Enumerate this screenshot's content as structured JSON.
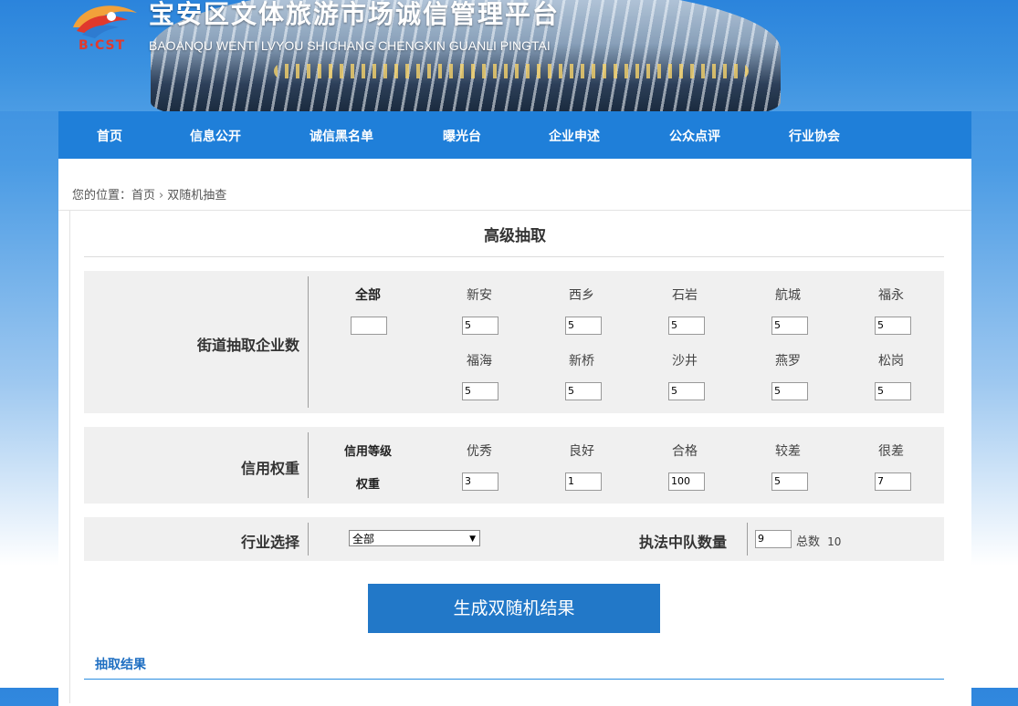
{
  "header": {
    "logo_text": "B·CST",
    "title": "宝安区文体旅游市场诚信管理平台",
    "subtitle": "BAOANQU WENTI LVYOU SHICHANG CHENGXIN GUANLI PINGTAI"
  },
  "nav": {
    "items": [
      "首页",
      "信息公开",
      "诚信黑名单",
      "曝光台",
      "企业申述",
      "公众点评",
      "行业协会"
    ]
  },
  "breadcrumb": {
    "prefix": "您的位置：",
    "home": "首页",
    "separator": "›",
    "current": "双随机抽查"
  },
  "page_title": "高级抽取",
  "street_panel": {
    "label": "街道抽取企业数",
    "all_label": "全部",
    "all_value": "",
    "streets_row1": [
      {
        "name": "新安",
        "value": "5"
      },
      {
        "name": "西乡",
        "value": "5"
      },
      {
        "name": "石岩",
        "value": "5"
      },
      {
        "name": "航城",
        "value": "5"
      },
      {
        "name": "福永",
        "value": "5"
      }
    ],
    "streets_row2": [
      {
        "name": "福海",
        "value": "5"
      },
      {
        "name": "新桥",
        "value": "5"
      },
      {
        "name": "沙井",
        "value": "5"
      },
      {
        "name": "燕罗",
        "value": "5"
      },
      {
        "name": "松岗",
        "value": "5"
      }
    ]
  },
  "credit_panel": {
    "label": "信用权重",
    "grade_label": "信用等级",
    "weight_label": "权重",
    "grades": [
      {
        "name": "优秀",
        "weight": "3"
      },
      {
        "name": "良好",
        "weight": "1"
      },
      {
        "name": "合格",
        "weight": "100"
      },
      {
        "name": "较差",
        "weight": "5"
      },
      {
        "name": "很差",
        "weight": "7"
      }
    ]
  },
  "industry_panel": {
    "label": "行业选择",
    "selected": "全部",
    "squad_label": "执法中队数量",
    "squad_value": "9",
    "total_label": "总数",
    "total_value": "10"
  },
  "generate_button": "生成双随机结果",
  "result_tab": "抽取结果",
  "colors": {
    "nav_bg": "#1f7fd9",
    "button_bg": "#2278c8",
    "panel_bg": "#f0f0f0",
    "result_accent": "#1f6fc2"
  }
}
